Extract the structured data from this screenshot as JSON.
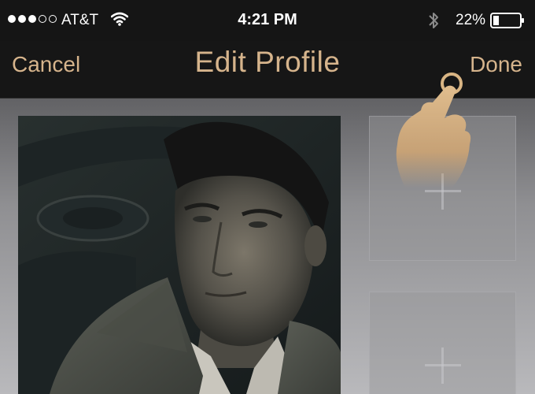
{
  "status_bar": {
    "carrier": "AT&T",
    "time": "4:21 PM",
    "battery_percent": "22%",
    "signal_bars_filled": 3,
    "signal_bars_total": 5,
    "battery_level": 0.22,
    "icons": [
      "wifi-icon",
      "bluetooth-icon",
      "battery-icon"
    ]
  },
  "nav": {
    "cancel_label": "Cancel",
    "title": "Edit Profile",
    "done_label": "Done"
  },
  "photos": {
    "main_photo": "profile-photo",
    "empty_slot_icon": "plus-icon",
    "empty_slots": 2
  },
  "overlay": {
    "icon": "tap-hand-icon"
  },
  "colors": {
    "accent": "#d6b48c",
    "bar_background": "#161616"
  }
}
